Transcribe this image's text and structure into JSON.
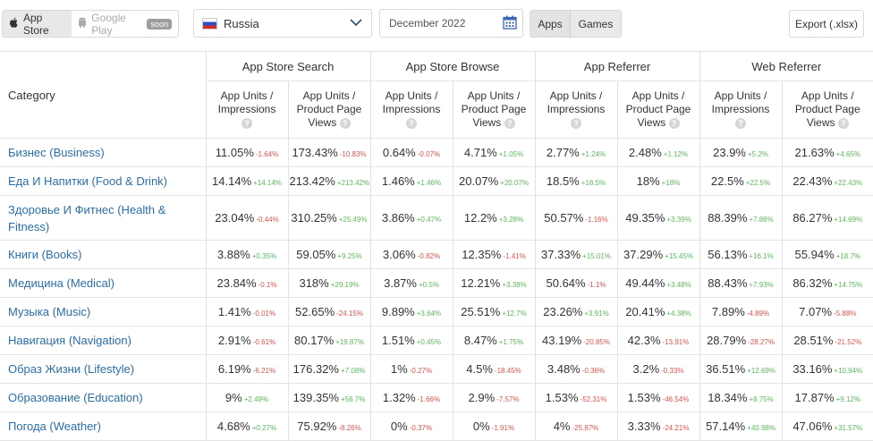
{
  "toolbar": {
    "store_toggle": {
      "app_store_label": "App Store",
      "google_play_label": "Google Play",
      "soon_badge": "soon"
    },
    "country": "Russia",
    "date": "December 2022",
    "type_toggle": {
      "apps_label": "Apps",
      "games_label": "Games"
    },
    "export_label": "Export (.xlsx)"
  },
  "table": {
    "category_header": "Category",
    "groups": [
      "App Store Search",
      "App Store Browse",
      "App Referrer",
      "Web Referrer"
    ],
    "metric_1_line1": "App Units /",
    "metric_1_line2": "Impressions",
    "metric_2_line1": "App Units /",
    "metric_2_line2": "Product Page",
    "metric_2_line3": "Views",
    "help_icon_glyph": "?",
    "rows": [
      {
        "name": "Бизнес (Business)",
        "cells": [
          [
            "11.05%",
            "-1.64%"
          ],
          [
            "173.43%",
            "-10.83%"
          ],
          [
            "0.64%",
            "-0.07%"
          ],
          [
            "4.71%",
            "+1.05%"
          ],
          [
            "2.77%",
            "+1.24%"
          ],
          [
            "2.48%",
            "+1.12%"
          ],
          [
            "23.9%",
            "+5.2%"
          ],
          [
            "21.63%",
            "+4.65%"
          ]
        ]
      },
      {
        "name": "Еда И Напитки (Food & Drink)",
        "cells": [
          [
            "14.14%",
            "+14.14%"
          ],
          [
            "213.42%",
            "+213.42%"
          ],
          [
            "1.46%",
            "+1.46%"
          ],
          [
            "20.07%",
            "+20.07%"
          ],
          [
            "18.5%",
            "+18.5%"
          ],
          [
            "18%",
            "+18%"
          ],
          [
            "22.5%",
            "+22.5%"
          ],
          [
            "22.43%",
            "+22.43%"
          ]
        ]
      },
      {
        "name": "Здоровье И Фитнес (Health & Fitness)",
        "cells": [
          [
            "23.04%",
            "-0.44%"
          ],
          [
            "310.25%",
            "+25.49%"
          ],
          [
            "3.86%",
            "+0.47%"
          ],
          [
            "12.2%",
            "+3.28%"
          ],
          [
            "50.57%",
            "-1.16%"
          ],
          [
            "49.35%",
            "+3.39%"
          ],
          [
            "88.39%",
            "+7.88%"
          ],
          [
            "86.27%",
            "+14.69%"
          ]
        ]
      },
      {
        "name": "Книги (Books)",
        "cells": [
          [
            "3.88%",
            "+0.35%"
          ],
          [
            "59.05%",
            "+9.25%"
          ],
          [
            "3.06%",
            "-0.82%"
          ],
          [
            "12.35%",
            "-1.41%"
          ],
          [
            "37.33%",
            "+15.01%"
          ],
          [
            "37.29%",
            "+15.45%"
          ],
          [
            "56.13%",
            "+16.1%"
          ],
          [
            "55.94%",
            "+18.7%"
          ]
        ]
      },
      {
        "name": "Медицина (Medical)",
        "cells": [
          [
            "23.84%",
            "-0.1%"
          ],
          [
            "318%",
            "+29.19%"
          ],
          [
            "3.87%",
            "+0.5%"
          ],
          [
            "12.21%",
            "+3.38%"
          ],
          [
            "50.64%",
            "-1.1%"
          ],
          [
            "49.44%",
            "+3.48%"
          ],
          [
            "88.43%",
            "+7.93%"
          ],
          [
            "86.32%",
            "+14.75%"
          ]
        ]
      },
      {
        "name": "Музыка (Music)",
        "cells": [
          [
            "1.41%",
            "-0.01%"
          ],
          [
            "52.65%",
            "-24.15%"
          ],
          [
            "9.89%",
            "+3.64%"
          ],
          [
            "25.51%",
            "+12.7%"
          ],
          [
            "23.26%",
            "+3.91%"
          ],
          [
            "20.41%",
            "+4.38%"
          ],
          [
            "7.89%",
            "-4.89%"
          ],
          [
            "7.07%",
            "-5.88%"
          ]
        ]
      },
      {
        "name": "Навигация (Navigation)",
        "cells": [
          [
            "2.91%",
            "-0.61%"
          ],
          [
            "80.17%",
            "+19.87%"
          ],
          [
            "1.51%",
            "+0.45%"
          ],
          [
            "8.47%",
            "+1.75%"
          ],
          [
            "43.19%",
            "-20.85%"
          ],
          [
            "42.3%",
            "-13.91%"
          ],
          [
            "28.79%",
            "-28.27%"
          ],
          [
            "28.51%",
            "-21.52%"
          ]
        ]
      },
      {
        "name": "Образ Жизни (Lifestyle)",
        "cells": [
          [
            "6.19%",
            "-6.21%"
          ],
          [
            "176.32%",
            "+7.08%"
          ],
          [
            "1%",
            "-0.27%"
          ],
          [
            "4.5%",
            "-18.45%"
          ],
          [
            "3.48%",
            "-0.36%"
          ],
          [
            "3.2%",
            "-0.33%"
          ],
          [
            "36.51%",
            "+12.69%"
          ],
          [
            "33.16%",
            "+10.94%"
          ]
        ]
      },
      {
        "name": "Образование (Education)",
        "cells": [
          [
            "9%",
            "+2.49%"
          ],
          [
            "139.35%",
            "+56.7%"
          ],
          [
            "1.32%",
            "-1.66%"
          ],
          [
            "2.9%",
            "-7.57%"
          ],
          [
            "1.53%",
            "-52.31%"
          ],
          [
            "1.53%",
            "-46.54%"
          ],
          [
            "18.34%",
            "+8.75%"
          ],
          [
            "17.87%",
            "+9.12%"
          ]
        ]
      },
      {
        "name": "Погода (Weather)",
        "cells": [
          [
            "4.68%",
            "+0.27%"
          ],
          [
            "75.92%",
            "-8.26%"
          ],
          [
            "0%",
            "-0.37%"
          ],
          [
            "0%",
            "-1.91%"
          ],
          [
            "4%",
            "-25.87%"
          ],
          [
            "3.33%",
            "-24.21%"
          ],
          [
            "57.14%",
            "+40.98%"
          ],
          [
            "47.06%",
            "+31.57%"
          ]
        ]
      }
    ]
  }
}
